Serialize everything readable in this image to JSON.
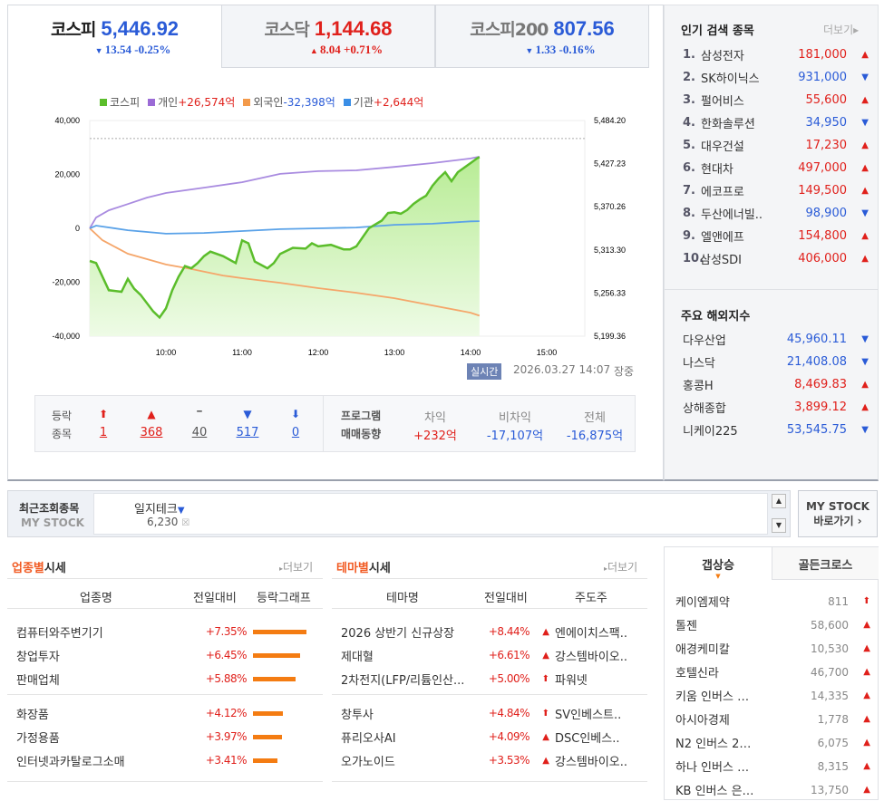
{
  "indices": [
    {
      "name": "코스피",
      "value": "5,446.92",
      "dir": "down",
      "change": "13.54 -0.25%"
    },
    {
      "name": "코스닥",
      "value": "1,144.68",
      "dir": "up",
      "change": "8.04 +0.71%"
    },
    {
      "name": "코스피200",
      "value": "807.56",
      "dir": "down",
      "change": "1.33 -0.16%"
    }
  ],
  "legend": [
    {
      "label": "코스피",
      "value": "",
      "color": "#5bbd2b"
    },
    {
      "label": "개인",
      "value": "+26,574억",
      "color": "#9b6bd6",
      "dir": "up"
    },
    {
      "label": "외국인",
      "value": "-32,398억",
      "color": "#f39a4a",
      "dir": "down"
    },
    {
      "label": "기관",
      "value": "+2,644억",
      "color": "#3a8ee6",
      "dir": "up"
    }
  ],
  "chart_data": {
    "type": "line",
    "title": "",
    "x_ticks": [
      "10:00",
      "11:00",
      "12:00",
      "13:00",
      "14:00",
      "15:00"
    ],
    "x_range": [
      "09:00",
      "15:30"
    ],
    "y_left_ticks": [
      "40,000",
      "20,000",
      "0",
      "-20,000",
      "-40,000"
    ],
    "y_left_range": [
      -40000,
      40000
    ],
    "y_right_ticks": [
      "5,484.20",
      "5,427.23",
      "5,370.26",
      "5,313.30",
      "5,256.33",
      "5,199.36"
    ],
    "y_right_range": [
      5199.36,
      5484.2
    ],
    "reference_line": 5460.46,
    "series": [
      {
        "name": "코스피",
        "axis": "right",
        "color": "#5bbd2b",
        "area": true,
        "points": [
          [
            "09:00",
            5298.7
          ],
          [
            "09:05",
            5296
          ],
          [
            "09:10",
            5278
          ],
          [
            "09:15",
            5260
          ],
          [
            "09:25",
            5258
          ],
          [
            "09:30",
            5275
          ],
          [
            "09:35",
            5262
          ],
          [
            "09:40",
            5254
          ],
          [
            "09:50",
            5232
          ],
          [
            "09:55",
            5224
          ],
          [
            "10:00",
            5236
          ],
          [
            "10:05",
            5260
          ],
          [
            "10:10",
            5278
          ],
          [
            "10:15",
            5292
          ],
          [
            "10:20",
            5289
          ],
          [
            "10:25",
            5296
          ],
          [
            "10:30",
            5305
          ],
          [
            "10:35",
            5311
          ],
          [
            "10:45",
            5305
          ],
          [
            "10:55",
            5296
          ],
          [
            "11:00",
            5326
          ],
          [
            "11:05",
            5322
          ],
          [
            "11:10",
            5298
          ],
          [
            "11:20",
            5289
          ],
          [
            "11:25",
            5296
          ],
          [
            "11:30",
            5308
          ],
          [
            "11:40",
            5316
          ],
          [
            "11:50",
            5315
          ],
          [
            "11:55",
            5322
          ],
          [
            "12:00",
            5318
          ],
          [
            "12:10",
            5320
          ],
          [
            "12:20",
            5314
          ],
          [
            "12:25",
            5314
          ],
          [
            "12:30",
            5318
          ],
          [
            "12:35",
            5330
          ],
          [
            "12:40",
            5342
          ],
          [
            "12:50",
            5352
          ],
          [
            "12:55",
            5362
          ],
          [
            "13:00",
            5363
          ],
          [
            "13:05",
            5361
          ],
          [
            "13:10",
            5366
          ],
          [
            "13:15",
            5374
          ],
          [
            "13:20",
            5380
          ],
          [
            "13:25",
            5385
          ],
          [
            "13:30",
            5398
          ],
          [
            "13:35",
            5408
          ],
          [
            "13:40",
            5416
          ],
          [
            "13:45",
            5404
          ],
          [
            "13:50",
            5416
          ],
          [
            "13:55",
            5422
          ],
          [
            "14:00",
            5428
          ],
          [
            "14:05",
            5434
          ],
          [
            "14:07",
            5436
          ]
        ]
      },
      {
        "name": "개인",
        "axis": "left",
        "color": "#a98be0",
        "points": [
          [
            "09:00",
            0
          ],
          [
            "09:05",
            4000
          ],
          [
            "09:15",
            6700
          ],
          [
            "09:30",
            9000
          ],
          [
            "09:45",
            11400
          ],
          [
            "10:00",
            13100
          ],
          [
            "10:30",
            15100
          ],
          [
            "11:00",
            17100
          ],
          [
            "11:30",
            20200
          ],
          [
            "12:00",
            21200
          ],
          [
            "12:30",
            21500
          ],
          [
            "13:00",
            22800
          ],
          [
            "13:30",
            24200
          ],
          [
            "14:00",
            25900
          ],
          [
            "14:07",
            26574
          ]
        ]
      },
      {
        "name": "외국인",
        "axis": "left",
        "color": "#f5a66a",
        "points": [
          [
            "09:00",
            0
          ],
          [
            "09:10",
            -4400
          ],
          [
            "09:30",
            -9400
          ],
          [
            "10:00",
            -13400
          ],
          [
            "10:20",
            -15100
          ],
          [
            "10:45",
            -17500
          ],
          [
            "11:00",
            -18500
          ],
          [
            "11:30",
            -20200
          ],
          [
            "12:00",
            -22200
          ],
          [
            "12:30",
            -23900
          ],
          [
            "13:00",
            -25900
          ],
          [
            "13:30",
            -28600
          ],
          [
            "14:00",
            -31300
          ],
          [
            "14:07",
            -32398
          ]
        ]
      },
      {
        "name": "기관",
        "axis": "left",
        "color": "#5aa2e8",
        "points": [
          [
            "09:00",
            0
          ],
          [
            "09:05",
            1000
          ],
          [
            "09:30",
            -700
          ],
          [
            "10:00",
            -2000
          ],
          [
            "10:30",
            -1700
          ],
          [
            "11:00",
            -1000
          ],
          [
            "11:30",
            -300
          ],
          [
            "12:00",
            0
          ],
          [
            "12:30",
            300
          ],
          [
            "13:00",
            1300
          ],
          [
            "13:30",
            1700
          ],
          [
            "14:00",
            2600
          ],
          [
            "14:07",
            2644
          ]
        ]
      }
    ]
  },
  "status": {
    "badge": "실시간",
    "datetime": "2026.03.27 14:07",
    "state": "장중"
  },
  "breadth": {
    "label1": "등락",
    "label2": "종목",
    "items": [
      {
        "icon": "⬆",
        "value": "1",
        "cls": "up"
      },
      {
        "icon": "▲",
        "value": "368",
        "cls": "up"
      },
      {
        "icon": "━",
        "value": "40",
        "cls": "flat"
      },
      {
        "icon": "▼",
        "value": "517",
        "cls": "dn"
      },
      {
        "icon": "⬇",
        "value": "0",
        "cls": "dn"
      }
    ]
  },
  "program": {
    "label1": "프로그램",
    "label2": "매매동향",
    "cols": [
      {
        "head": "차익",
        "value": "+232억",
        "cls": "up"
      },
      {
        "head": "비차익",
        "value": "-17,107억",
        "cls": "dn"
      },
      {
        "head": "전체",
        "value": "-16,875억",
        "cls": "dn"
      }
    ]
  },
  "popular": {
    "title": "인기 검색 종목",
    "more": "더보기",
    "items": [
      {
        "rank": "1.",
        "name": "삼성전자",
        "price": "181,000",
        "dir": "up"
      },
      {
        "rank": "2.",
        "name": "SK하이닉스",
        "price": "931,000",
        "dir": "down"
      },
      {
        "rank": "3.",
        "name": "펄어비스",
        "price": "55,600",
        "dir": "up"
      },
      {
        "rank": "4.",
        "name": "한화솔루션",
        "price": "34,950",
        "dir": "down"
      },
      {
        "rank": "5.",
        "name": "대우건설",
        "price": "17,230",
        "dir": "up"
      },
      {
        "rank": "6.",
        "name": "현대차",
        "price": "497,000",
        "dir": "up"
      },
      {
        "rank": "7.",
        "name": "에코프로",
        "price": "149,500",
        "dir": "up"
      },
      {
        "rank": "8.",
        "name": "두산에너빌..",
        "price": "98,900",
        "dir": "down"
      },
      {
        "rank": "9.",
        "name": "엘앤에프",
        "price": "154,800",
        "dir": "up"
      },
      {
        "rank": "10.",
        "name": "삼성SDI",
        "price": "406,000",
        "dir": "up"
      }
    ]
  },
  "overseas": {
    "title": "주요 해외지수",
    "items": [
      {
        "name": "다우산업",
        "value": "45,960.11",
        "dir": "down"
      },
      {
        "name": "나스닥",
        "value": "21,408.08",
        "dir": "down"
      },
      {
        "name": "홍콩H",
        "value": "8,469.83",
        "dir": "up"
      },
      {
        "name": "상해종합",
        "value": "3,899.12",
        "dir": "up"
      },
      {
        "name": "니케이225",
        "value": "53,545.75",
        "dir": "down"
      }
    ]
  },
  "mystock": {
    "label1": "최근조회종목",
    "label2": "MY STOCK",
    "stock_name": "일지테크",
    "stock_price": "6,230",
    "button1": "MY STOCK",
    "button2": "바로가기 ›"
  },
  "sector": {
    "title_hl": "업종별",
    "title": "시세",
    "more": "더보기",
    "headers": [
      "업종명",
      "전일대비",
      "등락그래프"
    ],
    "rows": [
      {
        "name": "컴퓨터와주변기기",
        "change": "+7.35%",
        "pct": 7.35
      },
      {
        "name": "창업투자",
        "change": "+6.45%",
        "pct": 6.45
      },
      {
        "name": "판매업체",
        "change": "+5.88%",
        "pct": 5.88
      },
      {
        "name": "화장품",
        "change": "+4.12%",
        "pct": 4.12
      },
      {
        "name": "가정용품",
        "change": "+3.97%",
        "pct": 3.97
      },
      {
        "name": "인터넷과카탈로그소매",
        "change": "+3.41%",
        "pct": 3.41
      }
    ]
  },
  "theme": {
    "title_hl": "테마별",
    "title": "시세",
    "more": "더보기",
    "headers": [
      "테마명",
      "전일대비",
      "주도주"
    ],
    "rows": [
      {
        "name": "2026 상반기 신규상장",
        "change": "+8.44%",
        "icon": "▲",
        "leader": "엔에이치스팩.."
      },
      {
        "name": "제대혈",
        "change": "+6.61%",
        "icon": "▲",
        "leader": "강스템바이오.."
      },
      {
        "name": "2차전지(LFP/리튬인산...",
        "change": "+5.00%",
        "icon": "⬆",
        "leader": "파워넷"
      },
      {
        "name": "창투사",
        "change": "+4.84%",
        "icon": "⬆",
        "leader": "SV인베스트.."
      },
      {
        "name": "퓨리오사AI",
        "change": "+4.09%",
        "icon": "▲",
        "leader": "DSC인베스.."
      },
      {
        "name": "오가노이드",
        "change": "+3.53%",
        "icon": "▲",
        "leader": "강스템바이오.."
      }
    ]
  },
  "gap": {
    "tabs": [
      "갭상승",
      "골든크로스"
    ],
    "rows": [
      {
        "name": "케이엠제약",
        "price": "811",
        "icon": "⬆"
      },
      {
        "name": "톨젠",
        "price": "58,600",
        "icon": "▲"
      },
      {
        "name": "애경케미칼",
        "price": "10,530",
        "icon": "▲"
      },
      {
        "name": "호텔신라",
        "price": "46,700",
        "icon": "▲"
      },
      {
        "name": "키움 인버스 …",
        "price": "14,335",
        "icon": "▲"
      },
      {
        "name": "아시아경제",
        "price": "1,778",
        "icon": "▲"
      },
      {
        "name": "N2 인버스 2…",
        "price": "6,075",
        "icon": "▲"
      },
      {
        "name": "하나 인버스 …",
        "price": "8,315",
        "icon": "▲"
      },
      {
        "name": "KB 인버스 은…",
        "price": "13,750",
        "icon": "▲"
      }
    ]
  }
}
